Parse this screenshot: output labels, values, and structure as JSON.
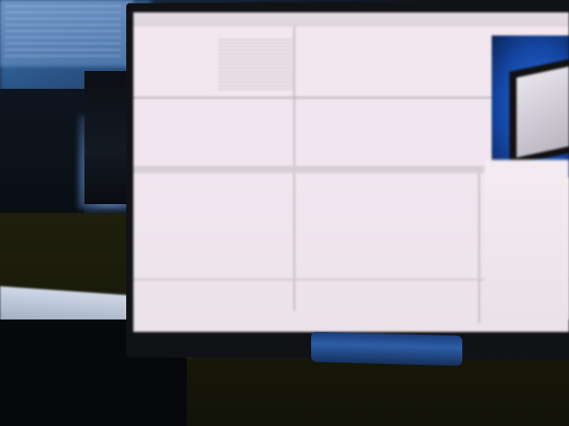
{
  "scene": {
    "description_type": "photo of monitor",
    "monitor_logo_text": "",
    "screen": {
      "top_toolbar_labels": [
        "",
        ""
      ],
      "caption_texts": [
        "",
        "",
        "",
        "",
        ""
      ]
    }
  },
  "colors": {
    "screen_bg": "#f1e6ef",
    "bezel": "#111216",
    "stand": "#2d5ea8",
    "thumbnail_blue": "#2b6fe0",
    "desk": "#1a1b0a"
  },
  "icons": [
    "monitor-icon",
    "laptop-icon",
    "cable-icon"
  ]
}
